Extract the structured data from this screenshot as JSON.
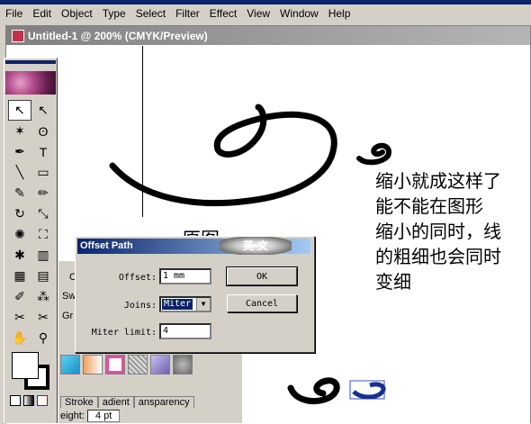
{
  "app": {
    "menu": [
      "File",
      "Edit",
      "Object",
      "Type",
      "Select",
      "Filter",
      "Effect",
      "View",
      "Window",
      "Help"
    ]
  },
  "document": {
    "title": "Untitled-1 @ 200% (CMYK/Preview)"
  },
  "canvas": {
    "original_label": "原图",
    "note_lines": [
      "缩小就成这样了",
      "能不能在图形",
      "缩小的同时，线",
      "的粗细也会同时",
      "变细"
    ]
  },
  "toolbox": {
    "tools": [
      {
        "name": "selection-tool-icon",
        "glyph": "↖"
      },
      {
        "name": "direct-selection-tool-icon",
        "glyph": "↖"
      },
      {
        "name": "magic-wand-tool-icon",
        "glyph": "✶"
      },
      {
        "name": "lasso-tool-icon",
        "glyph": "ʘ"
      },
      {
        "name": "pen-tool-icon",
        "glyph": "✒"
      },
      {
        "name": "type-tool-icon",
        "glyph": "T"
      },
      {
        "name": "line-tool-icon",
        "glyph": "╲"
      },
      {
        "name": "rectangle-tool-icon",
        "glyph": "▭"
      },
      {
        "name": "paintbrush-tool-icon",
        "glyph": "✎"
      },
      {
        "name": "pencil-tool-icon",
        "glyph": "✏"
      },
      {
        "name": "rotate-tool-icon",
        "glyph": "↻"
      },
      {
        "name": "scale-tool-icon",
        "glyph": "⤡"
      },
      {
        "name": "warp-tool-icon",
        "glyph": "✺"
      },
      {
        "name": "free-transform-tool-icon",
        "glyph": "⛶"
      },
      {
        "name": "symbol-sprayer-tool-icon",
        "glyph": "✱"
      },
      {
        "name": "graph-tool-icon",
        "glyph": "▥"
      },
      {
        "name": "mesh-tool-icon",
        "glyph": "▦"
      },
      {
        "name": "gradient-tool-icon",
        "glyph": "▤"
      },
      {
        "name": "eyedropper-tool-icon",
        "glyph": "✐"
      },
      {
        "name": "blend-tool-icon",
        "glyph": "⁂"
      },
      {
        "name": "slice-tool-icon",
        "glyph": "✂"
      },
      {
        "name": "scissors-tool-icon",
        "glyph": "✂"
      },
      {
        "name": "hand-tool-icon",
        "glyph": "✋"
      },
      {
        "name": "zoom-tool-icon",
        "glyph": "⚲"
      }
    ]
  },
  "panels": {
    "tab_c": "C",
    "tab_sw": "Sw",
    "tab_gr": "Gr",
    "stroke_tabs": [
      "Stroke",
      "adient",
      "ansparency"
    ],
    "weight_label": "eight:",
    "weight_value": "4 pt"
  },
  "dialog": {
    "title": "Offset Path",
    "stamp": "英 文",
    "offset_label": "Offset:",
    "offset_value": "1 mm",
    "joins_label": "Joins:",
    "joins_value": "Miter",
    "miter_label": "Miter limit:",
    "miter_value": "4",
    "ok_label": "OK",
    "cancel_label": "Cancel"
  }
}
